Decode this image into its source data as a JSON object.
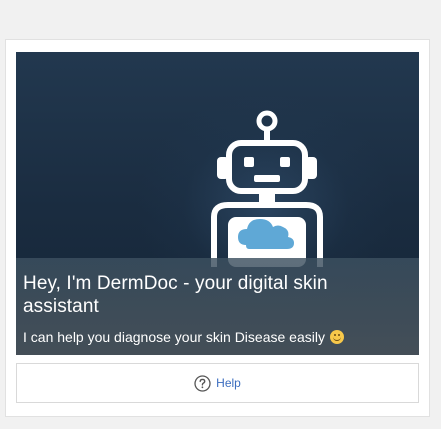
{
  "hero": {
    "title": "Hey, I'm DermDoc - your digital skin assistant",
    "subtitle": "I can help you diagnose your skin Disease easily",
    "emoji": "smiling-face-icon"
  },
  "help": {
    "label": "Help",
    "icon": "question-circle-icon"
  },
  "colors": {
    "hero_background": "#1b2d41",
    "caption_background": "#4a5863",
    "help_text": "#3b6dbf",
    "robot_stroke": "#ffffff",
    "cloud": "#5fa8d6"
  }
}
